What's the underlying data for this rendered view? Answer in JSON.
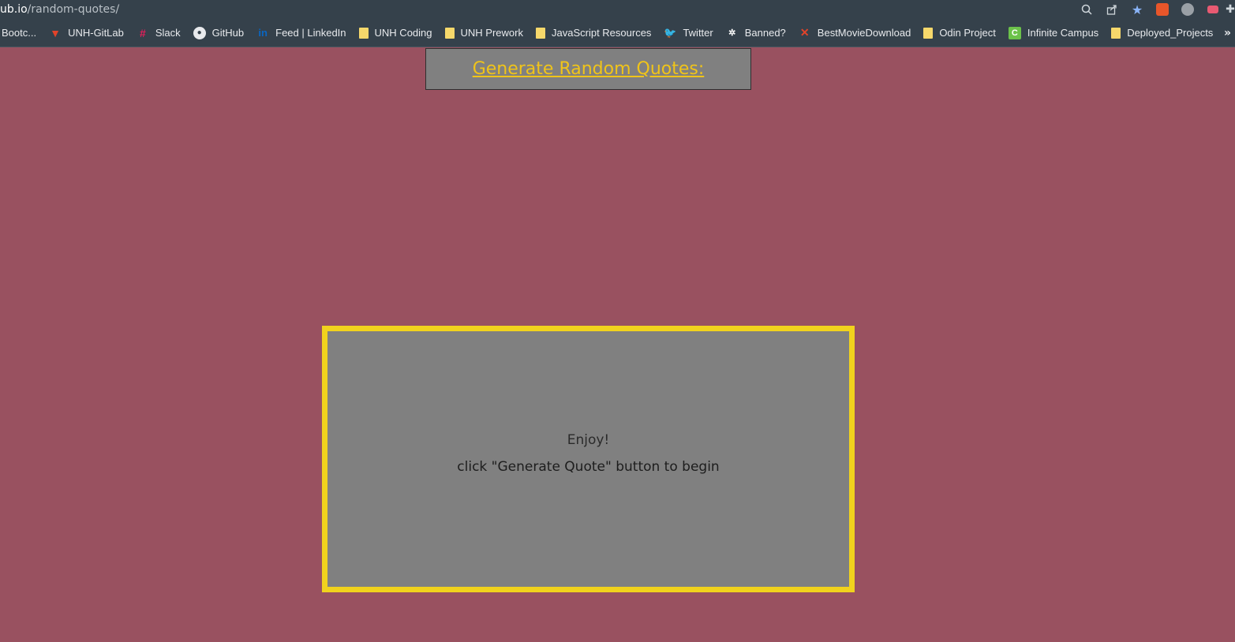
{
  "browser": {
    "url_host": "ub.io",
    "url_path": "/random-quotes/",
    "icons": [
      "zoom-icon",
      "share-icon",
      "bookmark-star-icon",
      "extension-icon-1",
      "extension-icon-2",
      "extension-icon-3",
      "extensions-puzzle-icon"
    ]
  },
  "bookmarks": [
    {
      "label": "Bootc...",
      "icon": "none"
    },
    {
      "label": "UNH-GitLab",
      "icon": "gitlab-icon"
    },
    {
      "label": "Slack",
      "icon": "slack-icon"
    },
    {
      "label": "GitHub",
      "icon": "github-icon"
    },
    {
      "label": "Feed | LinkedIn",
      "icon": "linkedin-icon"
    },
    {
      "label": "UNH Coding",
      "icon": "folder-icon"
    },
    {
      "label": "UNH Prework",
      "icon": "folder-icon"
    },
    {
      "label": "JavaScript Resources",
      "icon": "folder-icon"
    },
    {
      "label": "Twitter",
      "icon": "twitter-icon"
    },
    {
      "label": "Banned?",
      "icon": "banned-icon"
    },
    {
      "label": "BestMovieDownload",
      "icon": "x-icon"
    },
    {
      "label": "Odin Project",
      "icon": "folder-icon"
    },
    {
      "label": "Infinite Campus",
      "icon": "campus-icon"
    },
    {
      "label": "Deployed_Projects",
      "icon": "folder-icon"
    }
  ],
  "bookmarks_overflow": "»",
  "page": {
    "title": "Generate Random Quotes:",
    "quote_intro": "Enjoy!",
    "quote_instruction": "click \"Generate Quote\" button to begin"
  },
  "colors": {
    "page_background": "#995160",
    "box_gray": "#808080",
    "title_yellow": "#f0c419",
    "quote_border_yellow": "#f1d21d"
  }
}
